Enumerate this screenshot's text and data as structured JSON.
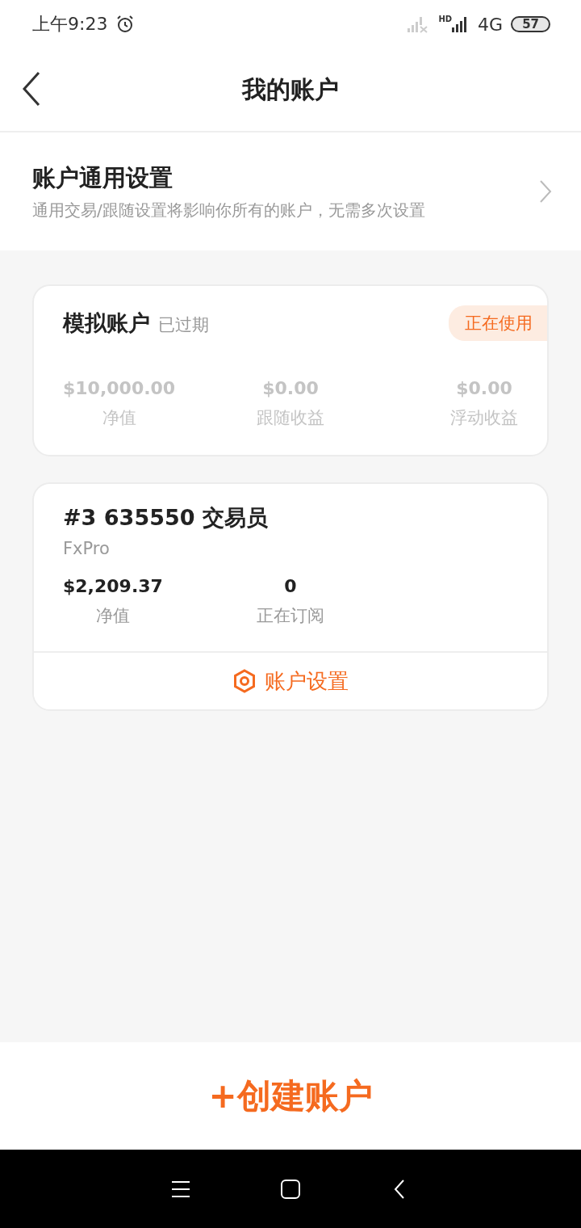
{
  "status_bar": {
    "time": "上午9:23",
    "hd": "HD",
    "network": "4G",
    "battery": "57"
  },
  "header": {
    "title": "我的账户"
  },
  "general_settings": {
    "title": "账户通用设置",
    "description": "通用交易/跟随设置将影响你所有的账户，无需多次设置"
  },
  "accounts": [
    {
      "title": "模拟账户",
      "status": "已过期",
      "expired": true,
      "badge": "正在使用",
      "stats": [
        {
          "value": "$10,000.00",
          "label": "净值"
        },
        {
          "value": "$0.00",
          "label": "跟随收益"
        },
        {
          "value": "$0.00",
          "label": "浮动收益"
        }
      ]
    },
    {
      "title": "#3 635550 交易员",
      "subtitle": "FxPro",
      "expired": false,
      "stats": [
        {
          "value": "$2,209.37",
          "label": "净值"
        },
        {
          "value": "0",
          "label": "正在订阅"
        }
      ],
      "action": "账户设置"
    }
  ],
  "create_button": "+创建账户"
}
